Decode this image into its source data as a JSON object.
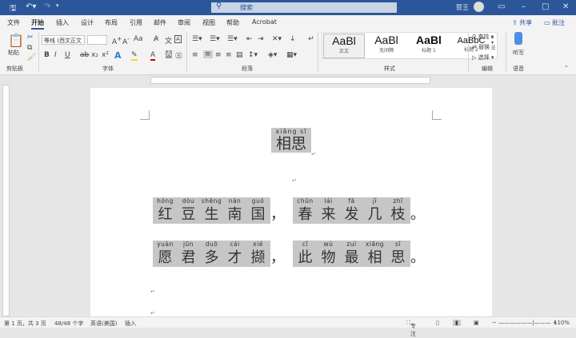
{
  "titlebar": {
    "doc_title": "跟着我学word",
    "search_placeholder": "搜索",
    "user": "赞王",
    "save_icon": "save-icon",
    "undo_icon": "undo-icon",
    "redo_icon": "redo-icon"
  },
  "tabs": [
    "文件",
    "开始",
    "插入",
    "设计",
    "布局",
    "引用",
    "邮件",
    "审阅",
    "视图",
    "帮助",
    "Acrobat"
  ],
  "share": "共享",
  "comment": "批注",
  "ribbon": {
    "clipboard": {
      "paste": "粘贴",
      "label": "剪贴板"
    },
    "font": {
      "name": "等线 (西文正文",
      "size": "",
      "label": "字体",
      "aa": "Aa"
    },
    "paragraph": {
      "label": "段落"
    },
    "styles": {
      "label": "样式",
      "items": [
        {
          "preview": "AaBl",
          "name": "正文"
        },
        {
          "preview": "AaBl",
          "name": "无间隔"
        },
        {
          "preview": "AaBl",
          "name": "标题 1"
        },
        {
          "preview": "AaBbC",
          "name": "标题 2"
        }
      ]
    },
    "editing": {
      "label": "编辑",
      "find": "查找",
      "replace": "替换",
      "select": "选择"
    },
    "voice": {
      "label": "语音",
      "dictate": "听写"
    }
  },
  "document": {
    "title": {
      "pinyin": "xiāng sī",
      "text": "相思"
    },
    "lines": [
      {
        "left": [
          [
            "hóng",
            "红"
          ],
          [
            "dòu",
            "豆"
          ],
          [
            "shēng",
            "生"
          ],
          [
            "nán",
            "南"
          ],
          [
            "guó",
            "国"
          ]
        ],
        "mid": "，",
        "right": [
          [
            "chūn",
            "春"
          ],
          [
            "lái",
            "来"
          ],
          [
            "fā",
            "发"
          ],
          [
            "jǐ",
            "几"
          ],
          [
            "zhī",
            "枝"
          ]
        ],
        "end": "。"
      },
      {
        "left": [
          [
            "yuàn",
            "愿"
          ],
          [
            "jūn",
            "君"
          ],
          [
            "duō",
            "多"
          ],
          [
            "cái",
            "才"
          ],
          [
            "xié",
            "撷"
          ]
        ],
        "mid": "，",
        "right": [
          [
            "cǐ",
            "此"
          ],
          [
            "wù",
            "物"
          ],
          [
            "zuì",
            "最"
          ],
          [
            "xiāng",
            "相"
          ],
          [
            "sī",
            "思"
          ]
        ],
        "end": "。"
      }
    ]
  },
  "status": {
    "page": "第 1 页，共 3 页",
    "words": "48/48 个字",
    "lang": "英语(美国)",
    "mode": "插入",
    "focus": "专注",
    "zoom": "110%"
  }
}
